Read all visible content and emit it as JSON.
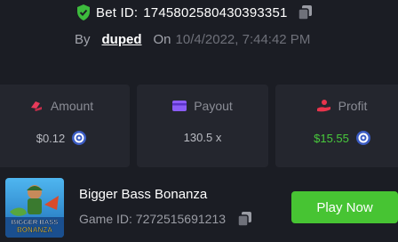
{
  "bet": {
    "id_label": "Bet ID:",
    "id_value": "1745802580430393351"
  },
  "meta": {
    "by_label": "By",
    "user": "duped",
    "on_label": "On",
    "date": "10/4/2022, 7:44:42 PM"
  },
  "stats": {
    "amount": {
      "label": "Amount",
      "value": "$0.12",
      "icon": "bet-chips-icon"
    },
    "payout": {
      "label": "Payout",
      "value": "130.5 x",
      "icon": "card-icon"
    },
    "profit": {
      "label": "Profit",
      "value": "$15.55",
      "icon": "hand-coin-icon"
    }
  },
  "game": {
    "title": "Bigger Bass Bonanza",
    "id_label": "Game ID:",
    "id_value": "7272515691213",
    "play_label": "Play Now",
    "thumb_text": [
      "BIGGER BASS",
      "BONANZA"
    ]
  },
  "colors": {
    "background": "#1b1d24",
    "card": "#24262e",
    "accent_green": "#47c433",
    "profit_green": "#48c93c",
    "payout_purple": "#8b5cf6",
    "amount_red": "#e83a5a"
  }
}
